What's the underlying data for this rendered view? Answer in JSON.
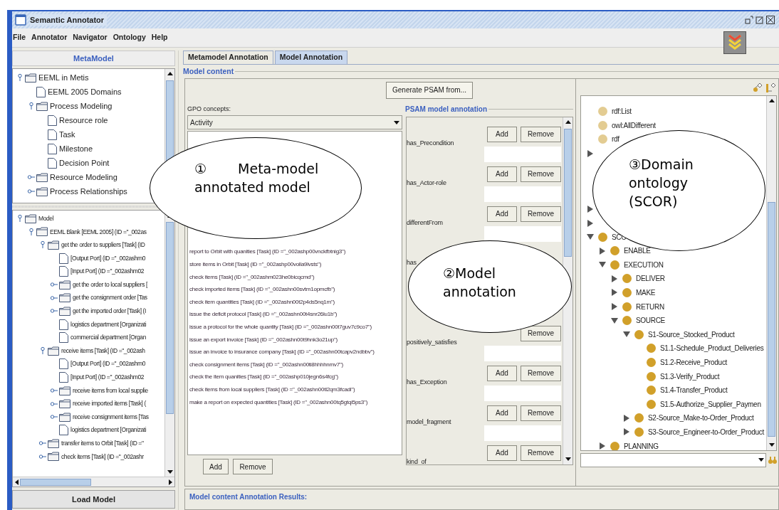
{
  "window": {
    "title": "Semantic Annotator"
  },
  "menu": [
    "File",
    "Annotator",
    "Navigator",
    "Ontology",
    "Help"
  ],
  "metamodel": {
    "title": "MetaModel",
    "tree": [
      {
        "label": "EEML in Metis",
        "kind": "folder",
        "expanded": true,
        "children": [
          {
            "label": "EEML 2005 Domains",
            "kind": "leaf"
          },
          {
            "label": "Process Modeling",
            "kind": "folder",
            "expanded": true,
            "children": [
              {
                "label": "Resource role",
                "kind": "leaf"
              },
              {
                "label": "Task",
                "kind": "leaf"
              },
              {
                "label": "Milestone",
                "kind": "leaf"
              },
              {
                "label": "Decision Point",
                "kind": "leaf"
              }
            ]
          },
          {
            "label": "Resource Modeling",
            "kind": "folder",
            "expanded": false
          },
          {
            "label": "Process Relationships",
            "kind": "folder",
            "expanded": false
          }
        ]
      }
    ]
  },
  "model_tree": [
    {
      "label": "Model",
      "kind": "folder",
      "expanded": true,
      "children": [
        {
          "label": "EEML Blank [EEML 2005] (ID =\"_002as",
          "kind": "folder",
          "expanded": true,
          "children": [
            {
              "label": "get the order to suppliers [Task] (ID",
              "kind": "folder",
              "expanded": true,
              "children": [
                {
                  "label": "[Output Port] (ID =\"_002ashm0",
                  "kind": "leaf"
                },
                {
                  "label": "[Input Port] (ID =\"_002ashm02",
                  "kind": "leaf"
                },
                {
                  "label": "get the order to local suppliers [",
                  "kind": "folder",
                  "expanded": false
                },
                {
                  "label": "get the consignment order [Tas",
                  "kind": "folder",
                  "expanded": false
                },
                {
                  "label": "get the imported order [Task] (I",
                  "kind": "folder",
                  "expanded": false
                },
                {
                  "label": "logistics department [Organizati",
                  "kind": "leaf"
                },
                {
                  "label": "commercial department [Organ",
                  "kind": "leaf"
                }
              ]
            },
            {
              "label": "receive items [Task] (ID =\"_002ash",
              "kind": "folder",
              "expanded": true,
              "children": [
                {
                  "label": "[Output Port] (ID =\"_002ashm0",
                  "kind": "leaf"
                },
                {
                  "label": "[Input Port] (ID =\"_002ashm02",
                  "kind": "leaf"
                },
                {
                  "label": "receive items from local supplie",
                  "kind": "folder",
                  "expanded": false
                },
                {
                  "label": "receive imported items [Task] (",
                  "kind": "folder",
                  "expanded": false
                },
                {
                  "label": "receive consignment items [Tas",
                  "kind": "folder",
                  "expanded": false
                },
                {
                  "label": "logistics department [Organizati",
                  "kind": "leaf"
                }
              ]
            },
            {
              "label": "transfer items to Orbit [Task] (ID =\"",
              "kind": "folder",
              "expanded": false
            },
            {
              "label": "check items [Task] (ID =\"_002ashr",
              "kind": "folder",
              "expanded": false
            }
          ]
        }
      ]
    }
  ],
  "load_button": "Load Model",
  "tabs": [
    {
      "label": "Metamodel Annotation",
      "selected": false
    },
    {
      "label": "Model Annotation",
      "selected": true
    }
  ],
  "model_content": {
    "title": "Model content",
    "generate_button": "Generate PSAM from...",
    "gpo_label": "GPO concepts:",
    "gpo_value": "Activity",
    "items": [
      "report to Orbit with quanities [Task] (ID =\"_002ashp00vnckfbtnig3\")",
      "store items in Orbit [Task] (ID =\"_002ashp00volla9lvsts\")",
      "check items [Task] (ID =\"_002ashm023he0bicqcmd\")",
      "check imported items [Task] (ID =\"_002ashn00svtm1opmcfb\")",
      "check item quantities [Task] (ID =\"_002ashn00t2p4ds5nq1m\")",
      "issue the deficit protocol [Task] (ID =\"_002ashn00t4snr26lu1b\")",
      "issue a protocol for the whole quantity [Task] (ID =\"_002ashn00t7guv7c9co7\")",
      "issue an export invoice [Task] (ID =\"_002ashn00t9hnk3o21up\")",
      "issue an invoice to insurance company [Task] (ID =\"_002ashn00tcapv2ndbbv\")",
      "check consignment items [Task] (ID =\"_002ashn00ti8hhhhnmv7\")",
      "check the item quanities [Task] (ID =\"_002ashp010jegn6s4fcg\")",
      "check items from local suppliers [Task] (ID =\"_002ashn00tl2qm3fcadi\")",
      "make a report on expected quantities [Task] (ID =\"_002ashn00tq5gtqi5ps3\")"
    ],
    "add": "Add",
    "remove": "Remove"
  },
  "psam": {
    "title": "PSAM model annotation",
    "rows": [
      {
        "kind": "full",
        "label": "has_Precondition",
        "add": "Add",
        "remove": "Remove"
      },
      {
        "kind": "full",
        "label": "has_Actor-role",
        "add": "Add",
        "remove": "Remove"
      },
      {
        "kind": "full",
        "label": "differentFrom",
        "add": "Add",
        "remove": "Remove"
      },
      {
        "kind": "covered",
        "label": "has"
      },
      {
        "kind": "covered"
      },
      {
        "kind": "full",
        "label": "positively_satisfies",
        "remove": "Remove"
      },
      {
        "kind": "full",
        "label": "has_Exception",
        "add": "Add",
        "remove": "Remove"
      },
      {
        "kind": "full",
        "label": "model_fragment",
        "add": "Add",
        "remove": "Remove"
      },
      {
        "kind": "full",
        "label": "kind_of",
        "add": "Add",
        "remove": "Remove"
      }
    ]
  },
  "ontology": {
    "tree": [
      {
        "kind": "builtin",
        "label": "rdf:List"
      },
      {
        "kind": "builtin",
        "label": "owl:AllDifferent"
      },
      {
        "kind": "builtin",
        "label": "rdf"
      },
      {
        "kind": "stub",
        "expanded": false
      },
      {
        "kind": "covered"
      },
      {
        "kind": "covered"
      },
      {
        "kind": "covered"
      },
      {
        "kind": "stub",
        "expanded": false
      },
      {
        "kind": "stub",
        "expanded": false
      },
      {
        "kind": "class",
        "label": "SCO",
        "expanded": true,
        "children": [
          {
            "kind": "class",
            "label": "ENABLE",
            "expanded": false
          },
          {
            "kind": "class",
            "label": "EXECUTION",
            "expanded": true,
            "children": [
              {
                "kind": "class",
                "label": "DELIVER",
                "expanded": false
              },
              {
                "kind": "class",
                "label": "MAKE",
                "expanded": false
              },
              {
                "kind": "class",
                "label": "RETURN",
                "expanded": false
              },
              {
                "kind": "class",
                "label": "SOURCE",
                "expanded": true,
                "children": [
                  {
                    "kind": "class",
                    "label": "S1-Source_Stocked_Product",
                    "expanded": true,
                    "children": [
                      {
                        "kind": "class",
                        "label": "S1.1-Schedule_Product_Deliveries"
                      },
                      {
                        "kind": "class",
                        "label": "S1.2-Receive_Product"
                      },
                      {
                        "kind": "class",
                        "label": "S1.3-Verify_Product"
                      },
                      {
                        "kind": "class",
                        "label": "S1.4-Transfer_Product"
                      },
                      {
                        "kind": "class",
                        "label": "S1.5-Authorize_Supplier_Paymen"
                      }
                    ]
                  },
                  {
                    "kind": "class",
                    "label": "S2-Source_Make-to-Order_Product",
                    "expanded": false
                  },
                  {
                    "kind": "class",
                    "label": "S3-Source_Engineer-to-Order_Product",
                    "expanded": false
                  }
                ]
              }
            ]
          },
          {
            "kind": "class",
            "label": "PLANNING",
            "expanded": false
          }
        ]
      }
    ]
  },
  "results_title": "Model content Annotation Results:",
  "callouts": [
    {
      "number": "①",
      "apart": true,
      "lines": [
        "Meta-model",
        "annotated model"
      ]
    },
    {
      "number": "②",
      "apart": false,
      "lines": [
        "Model",
        "annotation"
      ]
    },
    {
      "number": "③",
      "apart": false,
      "lines": [
        "Domain",
        "ontology",
        "(SCOR)"
      ]
    }
  ]
}
